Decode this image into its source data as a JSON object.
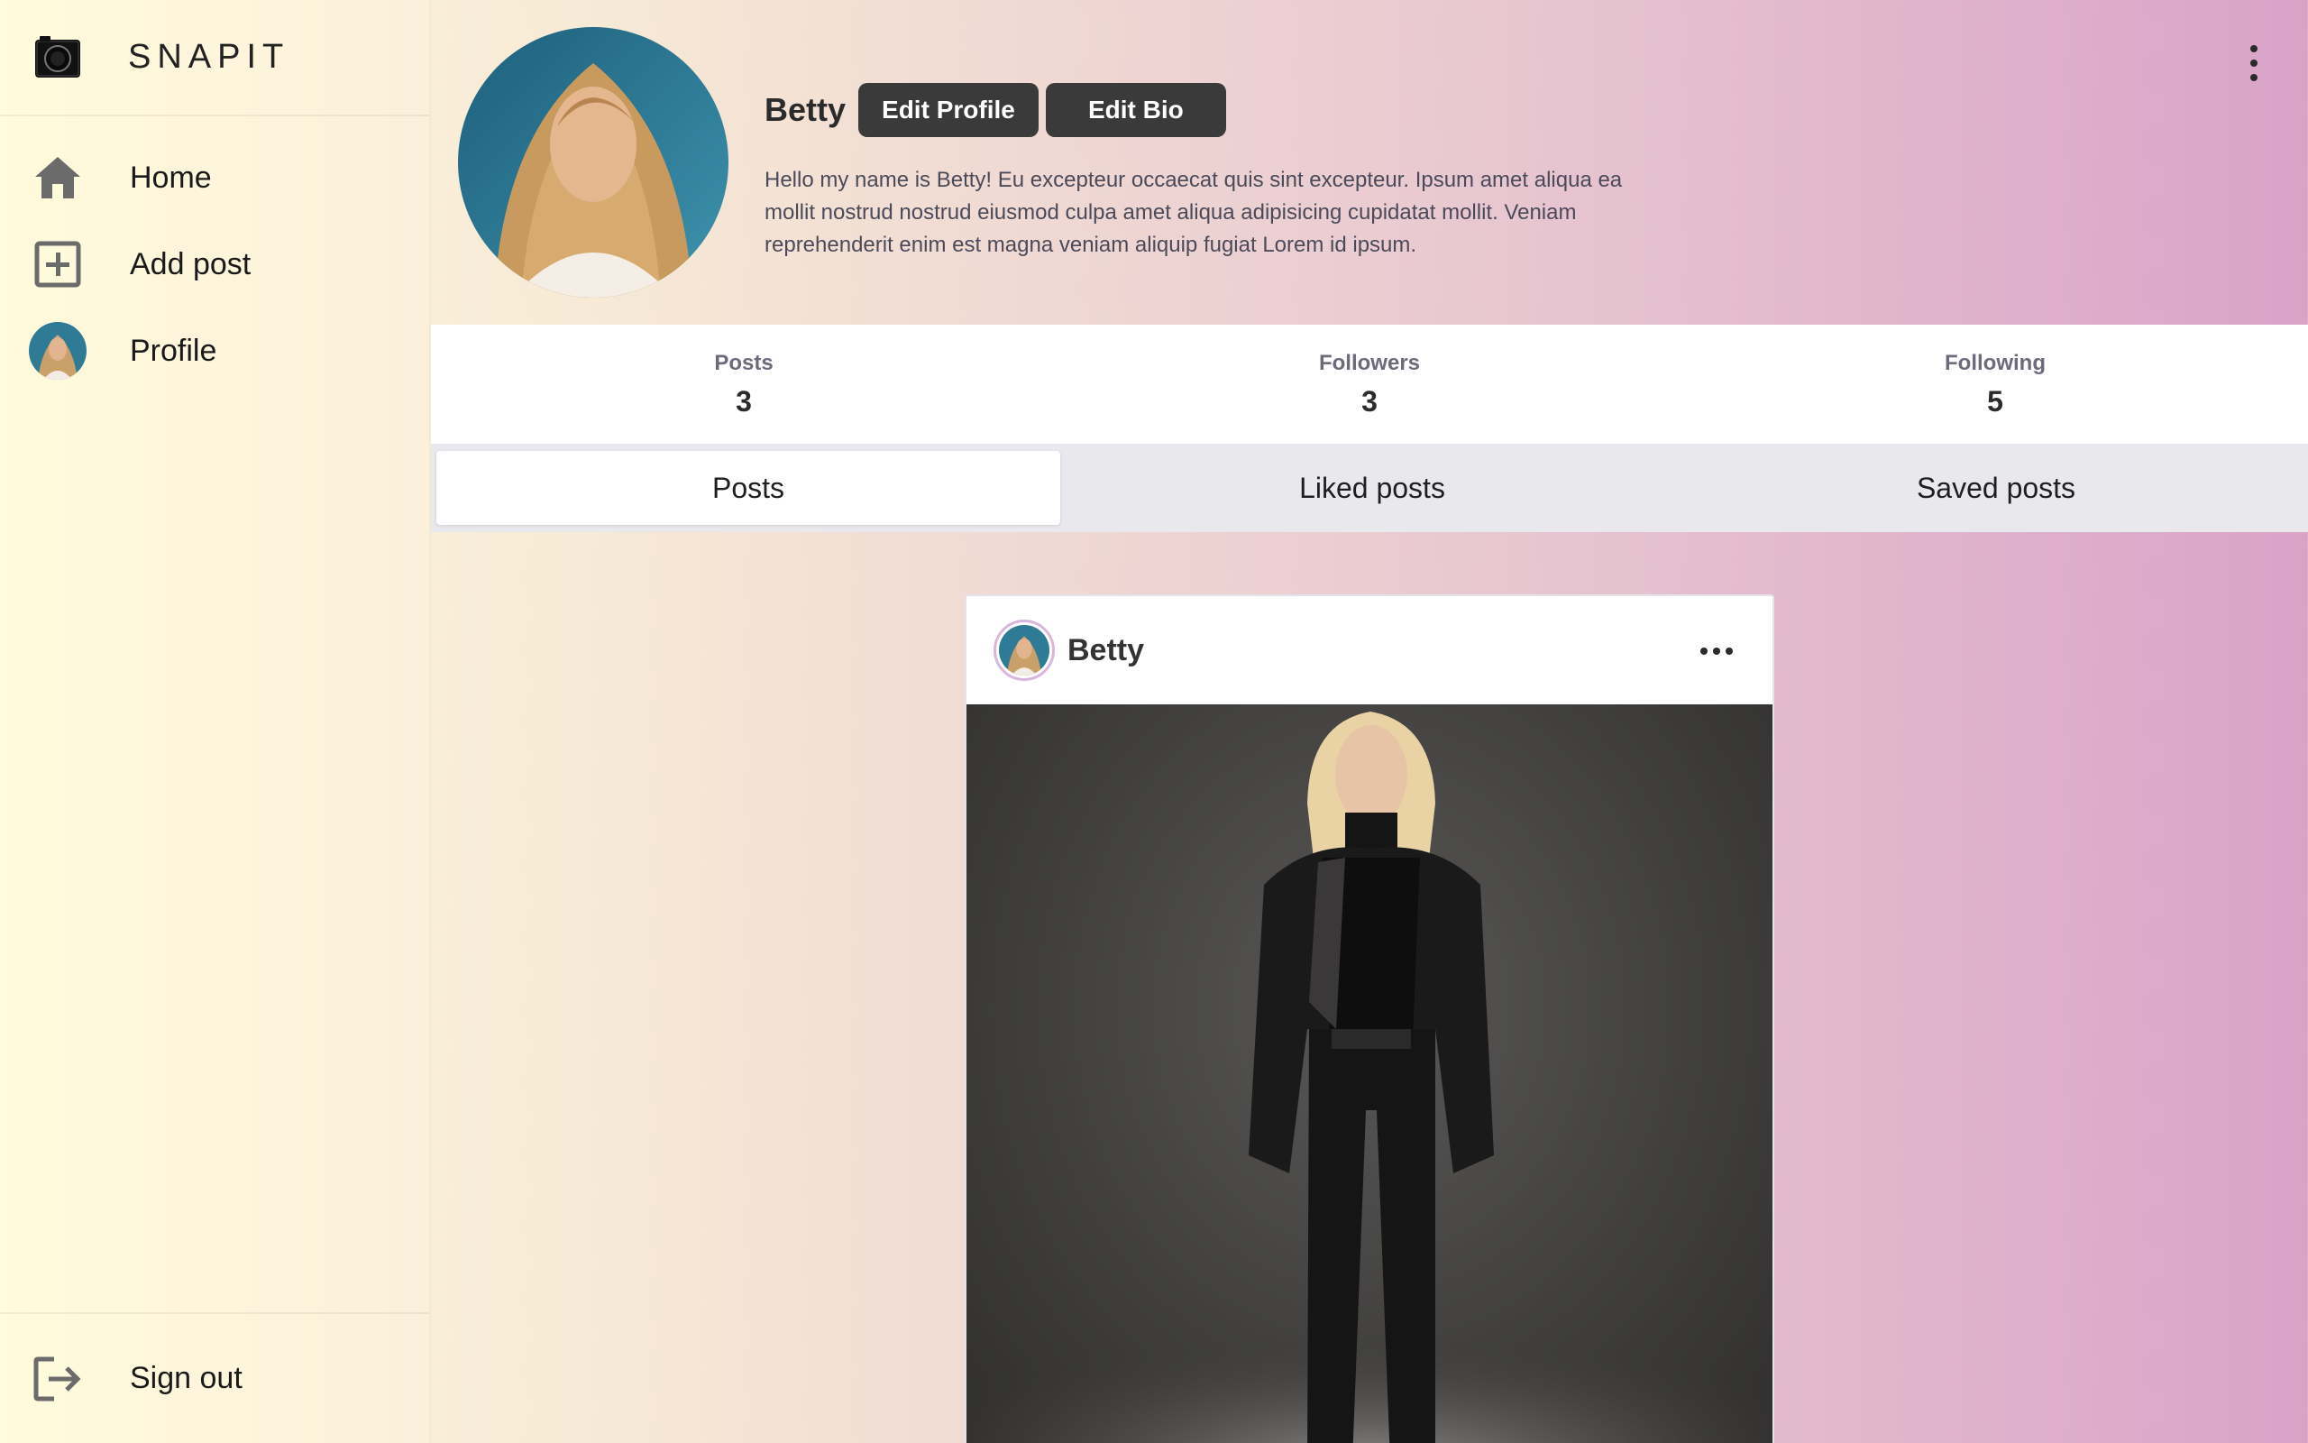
{
  "app": {
    "name": "SNAPIT"
  },
  "sidebar": {
    "items": [
      {
        "label": "Home",
        "icon": "home-icon"
      },
      {
        "label": "Add post",
        "icon": "add-box-icon"
      },
      {
        "label": "Profile",
        "icon": "avatar"
      }
    ],
    "signout": {
      "label": "Sign out",
      "icon": "logout-icon"
    }
  },
  "profile": {
    "name": "Betty",
    "edit_profile_label": "Edit Profile",
    "edit_bio_label": "Edit Bio",
    "bio": "Hello my name is Betty! Eu excepteur occaecat quis sint excepteur. Ipsum amet aliqua ea mollit nostrud nostrud eiusmod culpa amet aliqua adipisicing cupidatat mollit. Veniam reprehenderit enim est magna veniam aliquip fugiat Lorem id ipsum."
  },
  "stats": [
    {
      "label": "Posts",
      "value": "3"
    },
    {
      "label": "Followers",
      "value": "3"
    },
    {
      "label": "Following",
      "value": "5"
    }
  ],
  "tabs": [
    {
      "label": "Posts",
      "active": true
    },
    {
      "label": "Liked posts",
      "active": false
    },
    {
      "label": "Saved posts",
      "active": false
    }
  ],
  "post": {
    "username": "Betty"
  },
  "colors": {
    "button_bg": "#3a3a3a",
    "gradient_left": "#fff9e0",
    "gradient_right": "#d9a3c8"
  }
}
